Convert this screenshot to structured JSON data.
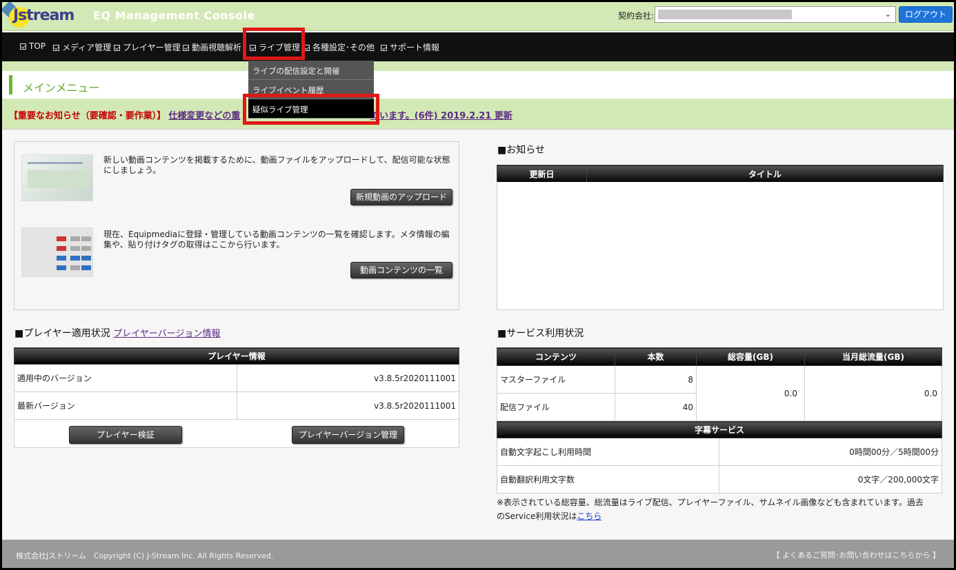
{
  "header": {
    "logo_text": "Jstream",
    "console_title": "EQ Management Console",
    "contract_label": "契約会社:",
    "logout_label": "ログアウト"
  },
  "nav": {
    "items": [
      "TOP",
      "メディア管理",
      "プレイヤー管理",
      "動画視聴解析",
      "ライブ管理",
      "各種設定･その他",
      "サポート情報"
    ],
    "highlighted": "ライブ管理"
  },
  "dropdown": {
    "items": [
      "ライブの配信設定と開催",
      "ライブイベント履歴",
      "疑似ライブ管理"
    ],
    "active": "疑似ライブ管理"
  },
  "menu_title": "メインメニュー",
  "notice": {
    "important": "【重要なお知らせ（要確認・要作業）】",
    "link_visible": "仕様変更などの重",
    "link_tail": "ています。(6件) 2019.2.21 更新"
  },
  "media": {
    "upload_desc": "新しい動画コンテンツを掲載するために、動画ファイルをアップロードして、配信可能な状態にしましょう。",
    "upload_button": "新規動画のアップロード",
    "list_desc": "現在、Equipmediaに登録・管理している動画コンテンツの一覧を確認します。メタ情報の編集や、貼り付けタグの取得はここから行います。",
    "list_button": "動画コンテンツの一覧"
  },
  "news": {
    "title": "■お知らせ",
    "col_date": "更新日",
    "col_title": "タイトル"
  },
  "player": {
    "title": "■プレイヤー適用状況",
    "link": "プレイヤーバージョン情報",
    "table_header": "プレイヤー情報",
    "rows": [
      {
        "label": "適用中のバージョン",
        "value": "v3.8.5r2020111001"
      },
      {
        "label": "最新バージョン",
        "value": "v3.8.5r2020111001"
      }
    ],
    "verify_button": "プレイヤー検証",
    "version_button": "プレイヤーバージョン管理"
  },
  "service": {
    "title": "■サービス利用状況",
    "headers": [
      "コンテンツ",
      "本数",
      "総容量(GB)",
      "当月総流量(GB)"
    ],
    "rows": [
      {
        "label": "マスターファイル",
        "count": "8"
      },
      {
        "label": "配信ファイル",
        "count": "40"
      }
    ],
    "total_capacity": "0.0",
    "monthly_traffic": "0.0",
    "subtitle_header": "字幕サービス",
    "subtitle_rows": [
      {
        "label": "自動文字起こし利用時間",
        "value": "0時間00分／5時間00分"
      },
      {
        "label": "自動翻訳利用文字数",
        "value": "0文字／200,000文字"
      }
    ],
    "footnote": "※表示されている総容量、総流量はライブ配信、プレイヤーファイル、サムネイル画像なども含まれています。過去のService利用状況は",
    "footnote_link": "こちら"
  },
  "footer": {
    "copyright": "株式会社Jストリーム　Copyright (C) J-Stream Inc. All Rights Reserved.",
    "faq": "【 よくあるご質問･お問い合わせはこちらから 】"
  },
  "colors": {
    "header_bg": "#d3e9b5",
    "nav_bg": "#111111",
    "highlight": "#e01818",
    "logout": "#1e73d8",
    "alert_red": "#c40000"
  }
}
